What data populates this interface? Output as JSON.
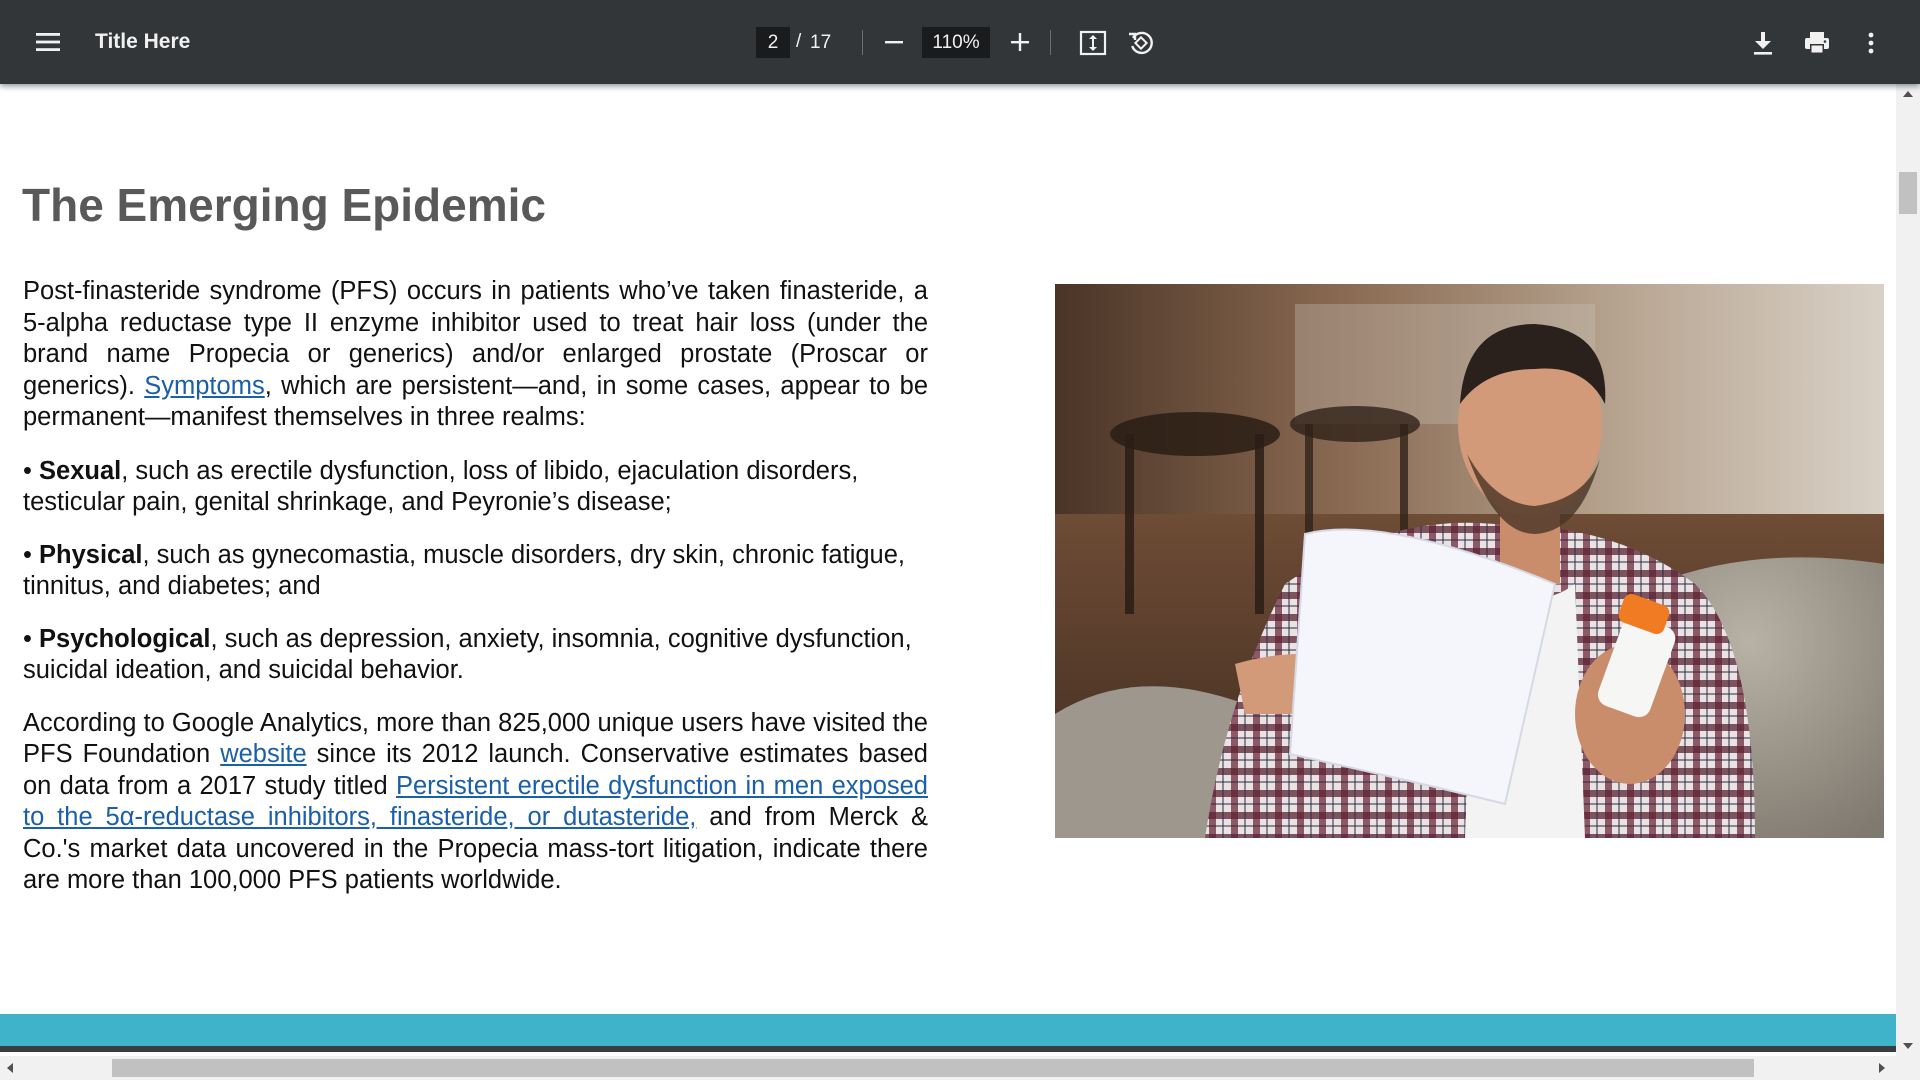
{
  "toolbar": {
    "title": "Title Here",
    "page_current": "2",
    "page_separator": "/",
    "page_total": "17",
    "zoom": "110%"
  },
  "document": {
    "heading": "The Emerging Epidemic",
    "intro": {
      "before_link": "Post-finasteride syndrome (PFS) occurs in patients who’ve taken finasteride, a 5-alpha reductase type II enzyme inhibitor used to treat hair loss (under the brand name Propecia or generics) and/or enlarged prostate (Proscar or generics). ",
      "link": "Symptoms",
      "after_link": ", which are persistent—and, in some cases, appear to be permanent—manifest themselves in three realms:"
    },
    "bullets": [
      {
        "marker": "• ",
        "term": "Sexual",
        "text": ", such as erectile dysfunction, loss of libido, ejaculation disorders, testicular pain, genital shrinkage, and Peyronie’s disease;"
      },
      {
        "marker": "• ",
        "term": "Physical",
        "text": ", such as gynecomastia, muscle disorders, dry skin, chronic fatigue, tinnitus, and diabetes; and"
      },
      {
        "marker": "• ",
        "term": "Psychological",
        "text": ", such as depression, anxiety, insomnia, cognitive dysfunction, suicidal ideation, and suicidal behavior."
      }
    ],
    "closing": {
      "part1": "According to Google Analytics, more than 825,000 unique users have visited the PFS Foundation ",
      "link1": "website",
      "part2": " since its 2012 launch. Conservative estimates based on data from a 2017 study titled ",
      "link2": "Persistent erectile dysfunction in men exposed to the 5α-reductase inhibitors, finasteride, or dutasteride,",
      "part3": " and from Merck & Co.'s market data uncovered in the Propecia mass-tort litigation, indicate there are more than 100,000 PFS patients worldwide."
    }
  },
  "colors": {
    "toolbar_bg": "#323639",
    "heading": "#595959",
    "link": "#1a5fa8",
    "footer_band": "#3fb3c9"
  },
  "icons": [
    "menu-icon",
    "zoom-out-icon",
    "zoom-in-icon",
    "fit-to-page-icon",
    "rotate-icon",
    "download-icon",
    "print-icon",
    "more-vert-icon"
  ]
}
